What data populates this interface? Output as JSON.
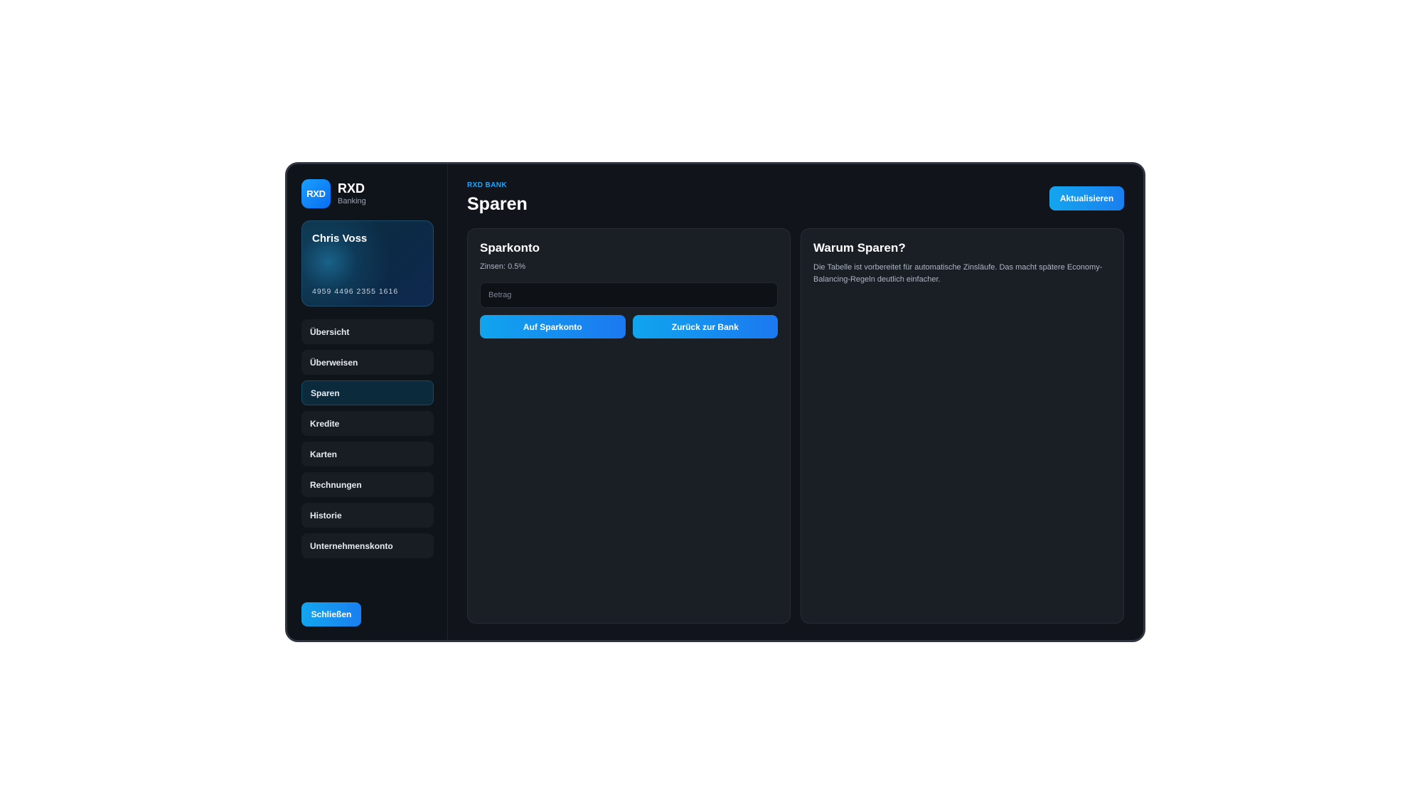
{
  "brand": {
    "logo_text": "RXD",
    "name": "RXD",
    "subtitle": "Banking"
  },
  "account": {
    "holder": "Chris Voss",
    "card_number": "4959 4496 2355 1616"
  },
  "nav": {
    "active": "Sparen",
    "items": [
      {
        "label": "Übersicht"
      },
      {
        "label": "Überweisen"
      },
      {
        "label": "Sparen"
      },
      {
        "label": "Kredite"
      },
      {
        "label": "Karten"
      },
      {
        "label": "Rechnungen"
      },
      {
        "label": "Historie"
      },
      {
        "label": "Unternehmenskonto"
      }
    ]
  },
  "sidebar_footer": {
    "close_label": "Schließen"
  },
  "header": {
    "eyebrow": "RXD BANK",
    "title": "Sparen",
    "refresh_label": "Aktualisieren"
  },
  "savings_panel": {
    "title": "Sparkonto",
    "interest": "Zinsen: 0.5%",
    "amount_placeholder": "Betrag",
    "amount_value": "",
    "deposit_label": "Auf Sparkonto",
    "withdraw_label": "Zurück zur Bank"
  },
  "info_panel": {
    "title": "Warum Sparen?",
    "text": "Die Tabelle ist vorbereitet für automatische Zinsläufe. Das macht spätere Economy-Balancing-Regeln deutlich einfacher."
  },
  "colors": {
    "accent": "#1a8ff0",
    "background": "#11141a",
    "panel": "#1a1e25",
    "active_nav": "#0b2b3d"
  }
}
